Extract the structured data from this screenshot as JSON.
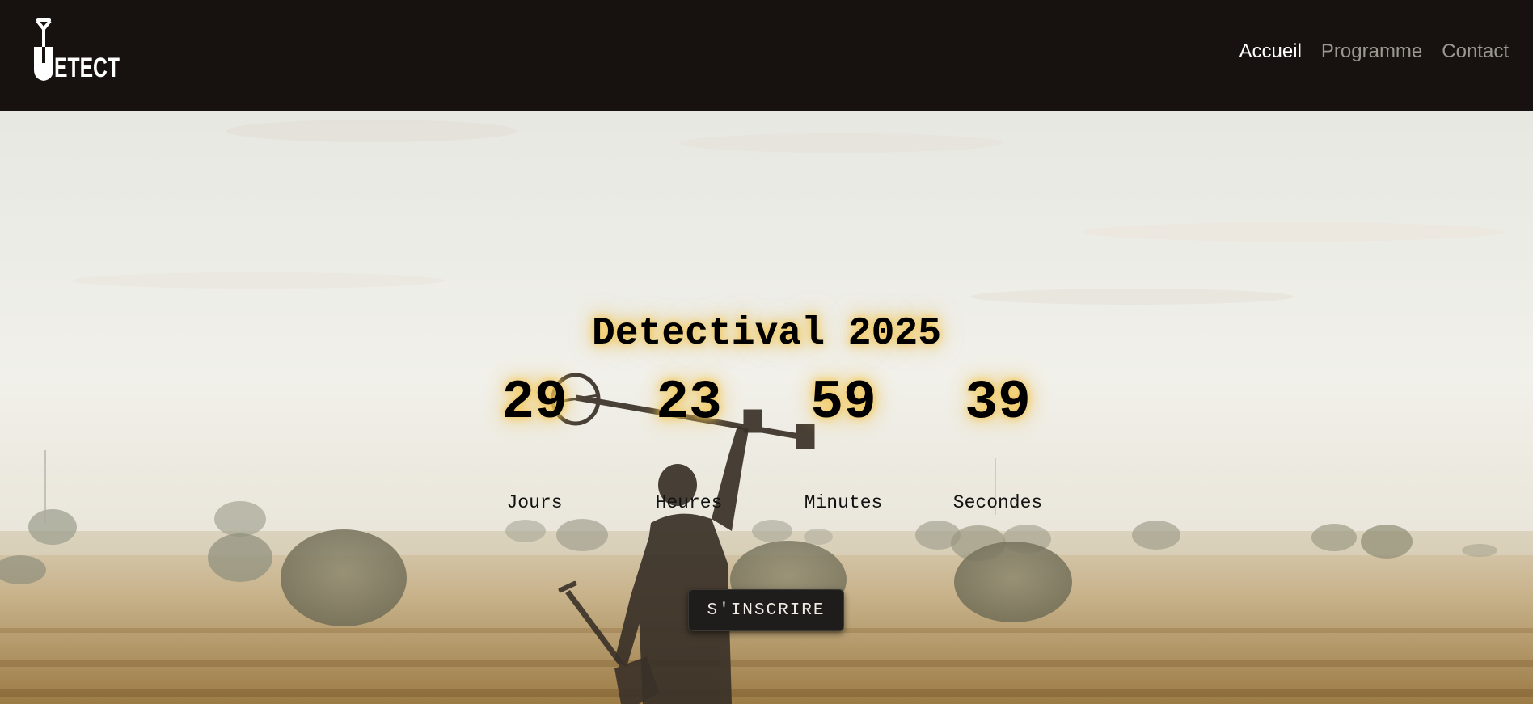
{
  "brand": {
    "logo_text": "DETECT",
    "logo_icon": "shovel-icon"
  },
  "nav": {
    "items": [
      {
        "label": "Accueil",
        "active": true
      },
      {
        "label": "Programme",
        "active": false
      },
      {
        "label": "Contact",
        "active": false
      }
    ]
  },
  "hero": {
    "title": "Detectival 2025",
    "countdown": [
      {
        "value": "29",
        "label": "Jours"
      },
      {
        "value": "23",
        "label": "Heures"
      },
      {
        "value": "59",
        "label": "Minutes"
      },
      {
        "value": "39",
        "label": "Secondes"
      }
    ],
    "cta_label": "S'INSCRIRE"
  },
  "colors": {
    "navbar_bg": "#17120f",
    "nav_active": "#ffffff",
    "nav_inactive": "#9b9791",
    "glow": "#f3c54f",
    "button_bg": "#1e1d1b"
  }
}
